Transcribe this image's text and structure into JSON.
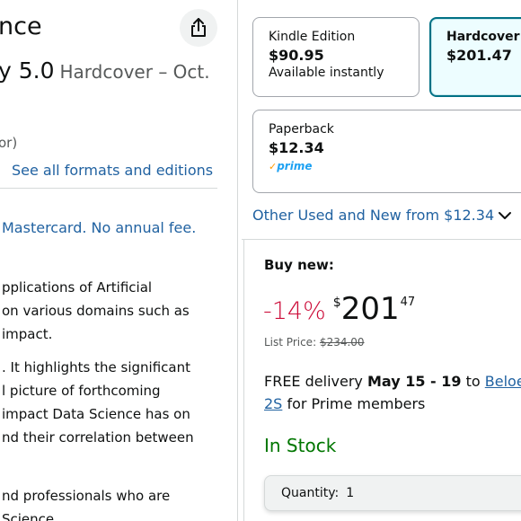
{
  "product": {
    "title_fragment": "nce",
    "edition_version": "y 5.0",
    "edition_format": "Hardcover – Oct.",
    "author_role": "or)",
    "see_all_formats": "See all formats and editions",
    "promo": "Mastercard. No annual fee.",
    "description_lines": [
      "pplications of Artificial",
      "on various domains such as",
      "impact.",
      ". It highlights the significant",
      "l picture of forthcoming",
      "impact Data Science has on",
      "nd their correlation between",
      "nd professionals who are",
      "Science"
    ]
  },
  "formats": [
    {
      "name": "Kindle Edition",
      "price": "$90.95",
      "note": "Available instantly",
      "selected": false
    },
    {
      "name": "Hardcover",
      "price": "$201.47",
      "note": "",
      "selected": true
    },
    {
      "name": "Paperback",
      "price": "$12.34",
      "badge": "prime",
      "selected": false
    }
  ],
  "other_offers": "Other Used and New from $12.34",
  "buybox": {
    "heading": "Buy new:",
    "discount": "-14%",
    "currency": "$",
    "price_whole": "201",
    "price_fraction": "47",
    "list_price_label": "List Price:",
    "list_price": "$234.00",
    "delivery_prefix": "FREE delivery",
    "delivery_dates": "May 15 - 19",
    "delivery_to": "to",
    "delivery_location_line1": "Beloe",
    "delivery_location_line2": "2S",
    "delivery_suffix": "for Prime members",
    "stock": "In Stock",
    "quantity_label": "Quantity:",
    "quantity_value": "1"
  },
  "colors": {
    "link": "#2162a1",
    "discount": "#cc0c39",
    "in_stock": "#007600",
    "selected_border": "#007185",
    "prime_blue": "#1da1f2",
    "prime_check": "#ff9900"
  },
  "icons": {
    "share": "share-icon",
    "chevron": "chevron-down-icon",
    "prime_check": "check-icon"
  }
}
